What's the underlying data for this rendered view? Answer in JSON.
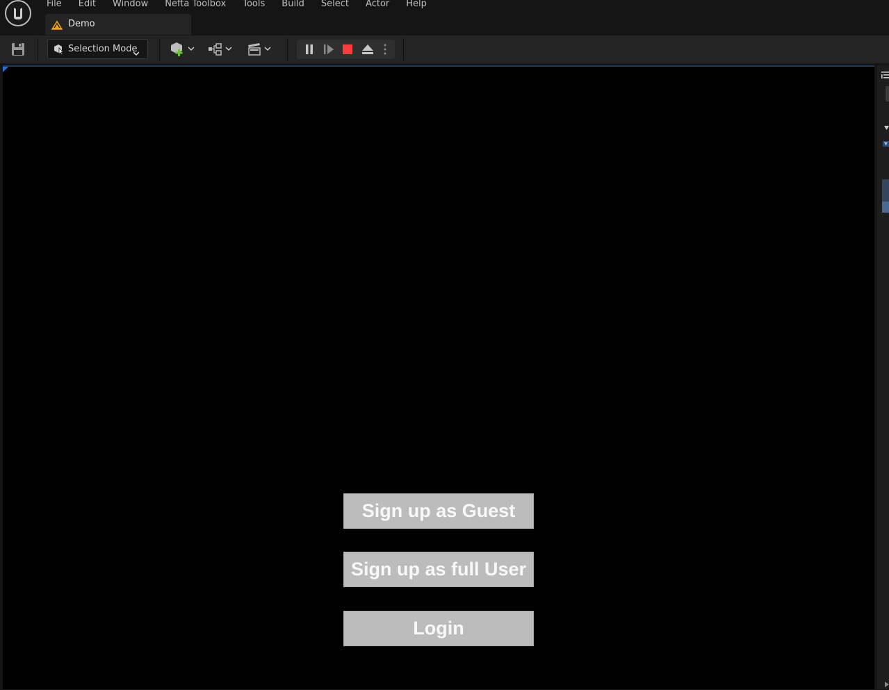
{
  "menu": {
    "items": [
      "File",
      "Edit",
      "Window",
      "Nefta Toolbox",
      "Tools",
      "Build",
      "Select",
      "Actor",
      "Help"
    ]
  },
  "document_tab": {
    "label": "Demo"
  },
  "toolbar": {
    "mode_label": "Selection Mode"
  },
  "game_ui": {
    "buttons": [
      {
        "label": "Sign up as Guest"
      },
      {
        "label": "Sign up as full User"
      },
      {
        "label": "Login"
      }
    ]
  },
  "colors": {
    "stop_red": "#ff3b3b",
    "add_green": "#6fc336",
    "tab_icon_orange": "#f0a020",
    "viewport_bg": "#000000",
    "button_bg": "#bcbcbc"
  }
}
